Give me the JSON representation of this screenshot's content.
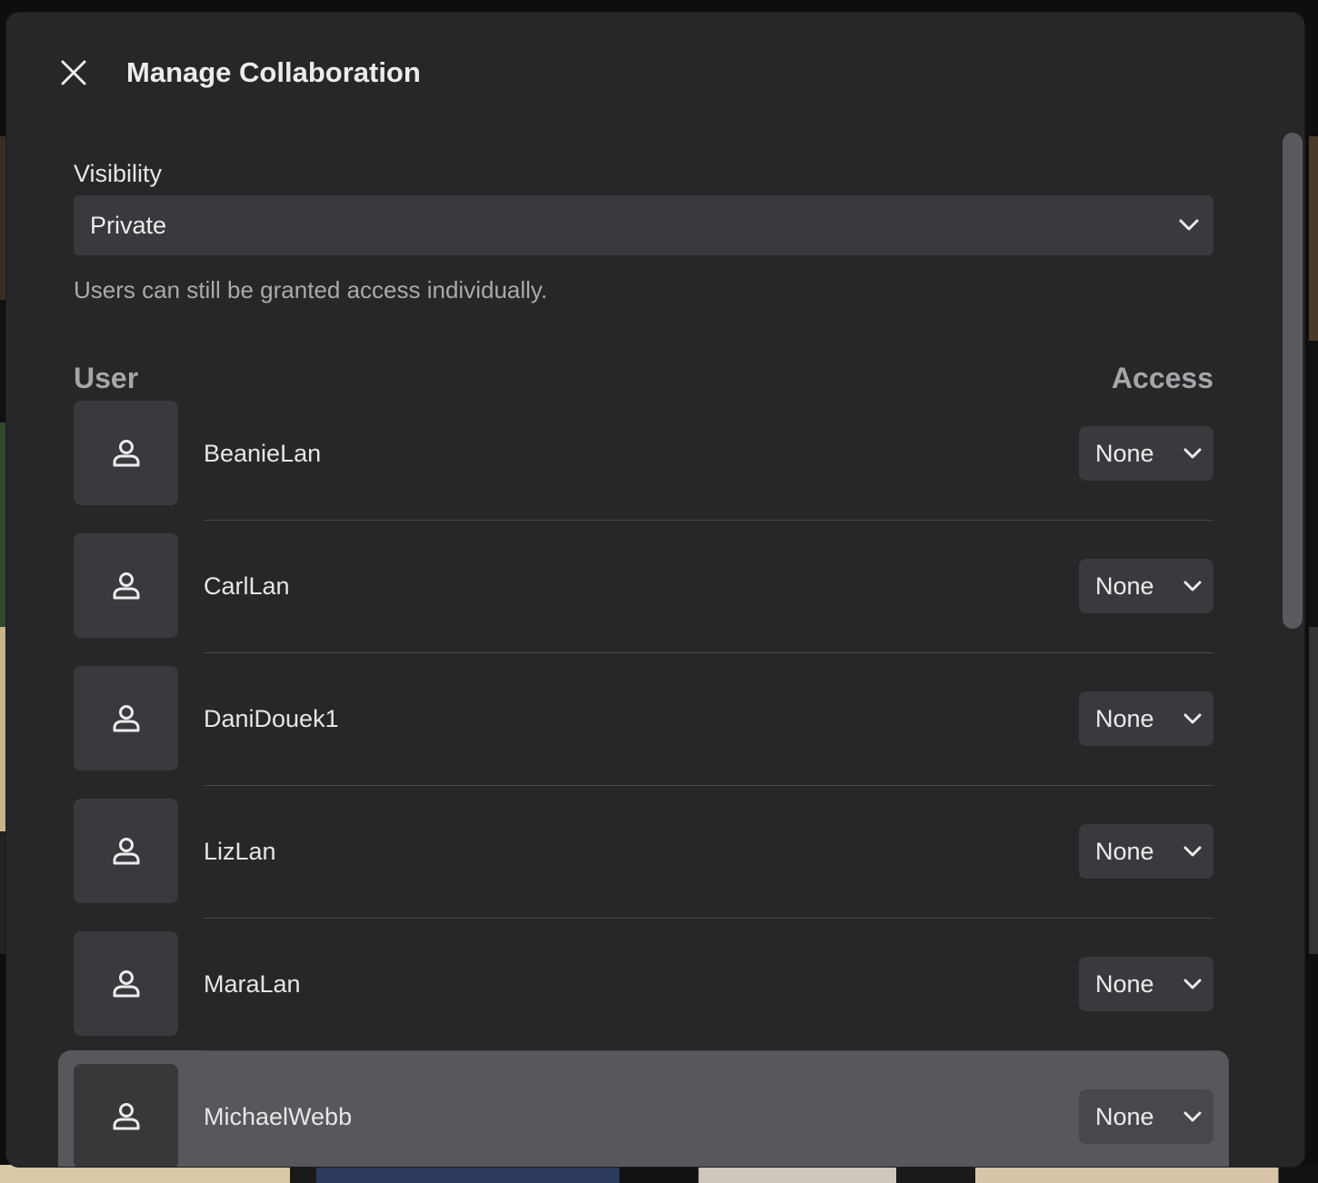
{
  "dialog": {
    "title": "Manage Collaboration",
    "close_icon": "close-icon"
  },
  "visibility": {
    "label": "Visibility",
    "selected": "Private",
    "hint": "Users can still be granted access individually."
  },
  "table": {
    "user_header": "User",
    "access_header": "Access",
    "users": [
      {
        "name": "BeanieLan",
        "access": "None"
      },
      {
        "name": "CarlLan",
        "access": "None"
      },
      {
        "name": "DaniDouek1",
        "access": "None"
      },
      {
        "name": "LizLan",
        "access": "None"
      },
      {
        "name": "MaraLan",
        "access": "None"
      },
      {
        "name": "MichaelWebb",
        "access": "None"
      }
    ]
  },
  "colors": {
    "modal_bg": "#272729",
    "control_bg": "#3a3a3e",
    "highlight_bg": "#58585c"
  }
}
